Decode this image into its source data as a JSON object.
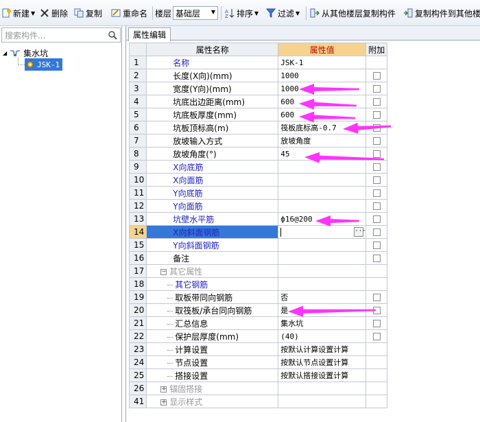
{
  "toolbar": {
    "new_label": "新建",
    "delete_label": "删除",
    "copy_label": "复制",
    "rename_label": "重命名",
    "floor_label": "楼层",
    "floor_value": "基础层",
    "sort_label": "排序",
    "filter_label": "过滤",
    "copy_from_floor_label": "从其他楼层复制构件",
    "copy_to_floor_label": "复制构件到其他楼"
  },
  "search": {
    "placeholder": "搜索构件..."
  },
  "tree": {
    "root_label": "集水坑",
    "child_label": "JSK-1"
  },
  "tab": {
    "label": "属性编辑"
  },
  "columns": {
    "name": "属性名称",
    "value": "属性值",
    "extra": "附加"
  },
  "rows": [
    {
      "idx": "1",
      "name": "名称",
      "value": "JSK-1",
      "style": "blue",
      "cb": false
    },
    {
      "idx": "2",
      "name": "长度(X向)(mm)",
      "value": "1000",
      "style": "",
      "cb": true
    },
    {
      "idx": "3",
      "name": "宽度(Y向)(mm)",
      "value": "1000",
      "style": "",
      "cb": true
    },
    {
      "idx": "4",
      "name": "坑底出边距离(mm)",
      "value": "600",
      "style": "",
      "cb": true
    },
    {
      "idx": "5",
      "name": "坑底板厚度(mm)",
      "value": "600",
      "style": "",
      "cb": true
    },
    {
      "idx": "6",
      "name": "坑板顶标高(m)",
      "value": "筏板底标高-0.7",
      "style": "",
      "cb": true
    },
    {
      "idx": "7",
      "name": "放坡输入方式",
      "value": "放坡角度",
      "style": "",
      "cb": true
    },
    {
      "idx": "8",
      "name": "放坡角度(°)",
      "value": "45",
      "style": "",
      "cb": true
    },
    {
      "idx": "9",
      "name": "X向底筋",
      "value": "",
      "style": "blue",
      "cb": true
    },
    {
      "idx": "10",
      "name": "X向面筋",
      "value": "",
      "style": "blue",
      "cb": true
    },
    {
      "idx": "11",
      "name": "Y向底筋",
      "value": "",
      "style": "blue",
      "cb": true
    },
    {
      "idx": "12",
      "name": "Y向面筋",
      "value": "",
      "style": "blue",
      "cb": true
    },
    {
      "idx": "13",
      "name": "坑壁水平筋",
      "value": "ф16@200",
      "style": "blue",
      "cb": true
    },
    {
      "idx": "14",
      "name": "X向斜面钢筋",
      "value": "",
      "style": "active",
      "cb": true
    },
    {
      "idx": "15",
      "name": "Y向斜面钢筋",
      "value": "",
      "style": "blue",
      "cb": true
    },
    {
      "idx": "16",
      "name": "备注",
      "value": "",
      "style": "",
      "cb": true
    },
    {
      "idx": "17",
      "name": "其它属性",
      "value": "",
      "style": "group-open",
      "cb": false
    },
    {
      "idx": "18",
      "name": "其它钢筋",
      "value": "",
      "style": "sub-blue",
      "cb": false
    },
    {
      "idx": "19",
      "name": "取板带同向钢筋",
      "value": "否",
      "style": "sub",
      "cb": true
    },
    {
      "idx": "20",
      "name": "取筏板/承台同向钢筋",
      "value": "是",
      "style": "sub",
      "cb": true
    },
    {
      "idx": "21",
      "name": "汇总信息",
      "value": "集水坑",
      "style": "sub",
      "cb": true
    },
    {
      "idx": "22",
      "name": "保护层厚度(mm)",
      "value": "(40)",
      "style": "sub",
      "cb": true
    },
    {
      "idx": "23",
      "name": "计算设置",
      "value": "按默认计算设置计算",
      "style": "sub",
      "cb": false
    },
    {
      "idx": "24",
      "name": "节点设置",
      "value": "按默认节点设置计算",
      "style": "sub",
      "cb": false
    },
    {
      "idx": "25",
      "name": "搭接设置",
      "value": "按默认搭接设置计算",
      "style": "sub",
      "cb": false
    },
    {
      "idx": "26",
      "name": "锚固搭接",
      "value": "",
      "style": "group-closed",
      "cb": false
    },
    {
      "idx": "41",
      "name": "显示样式",
      "value": "",
      "style": "group-closed",
      "cb": false
    }
  ],
  "colors": {
    "selection": "#3478d8",
    "value_header": "#f5d38e",
    "annotation_arrow": "#ff33ff",
    "blue_text": "#2020c0"
  },
  "icons": {
    "new": "new-icon",
    "delete": "delete-x-icon",
    "copy": "copy-icon",
    "rename": "rename-icon",
    "sort": "sort-icon",
    "filter": "funnel-icon",
    "search": "magnifier-icon"
  }
}
